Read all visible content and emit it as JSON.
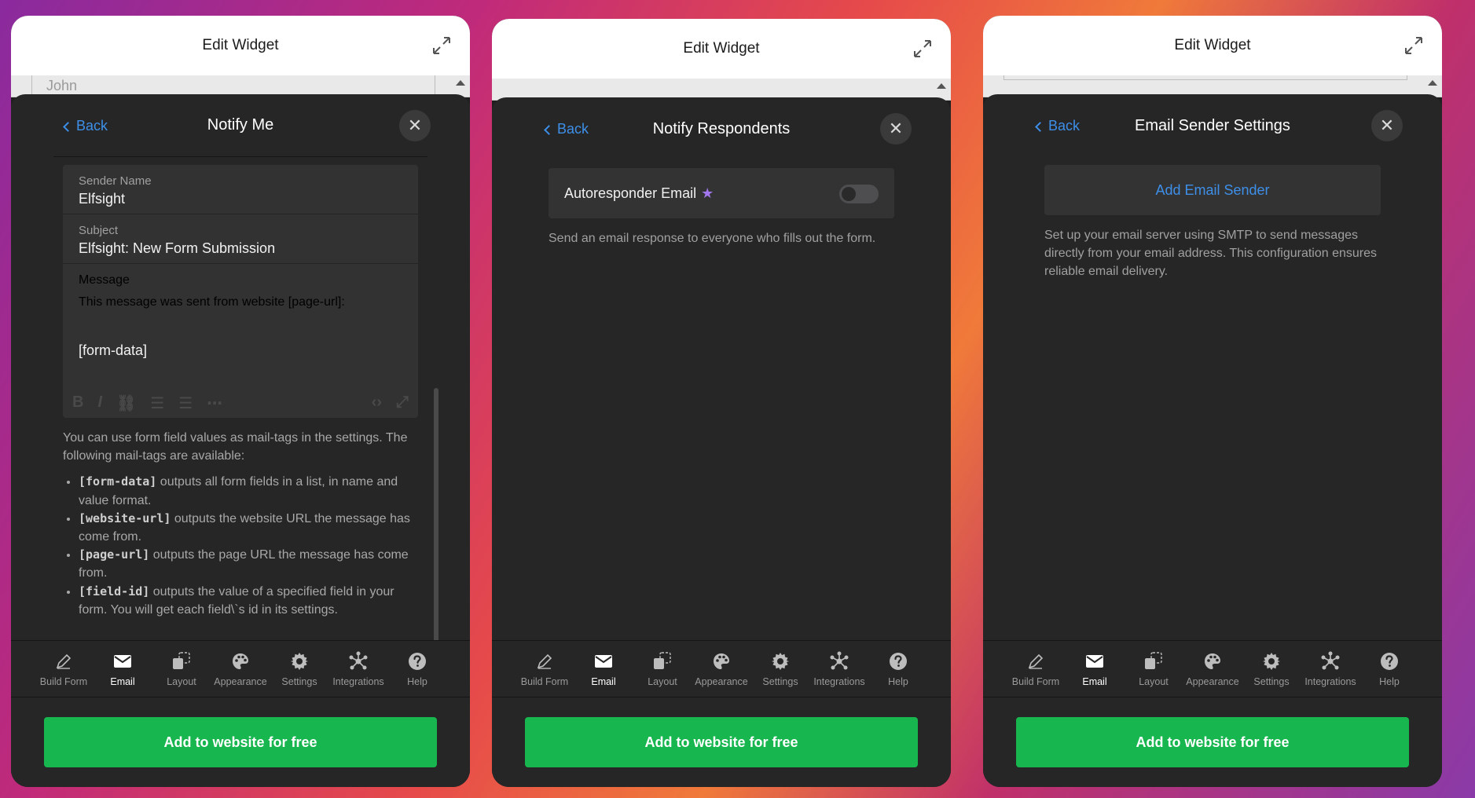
{
  "colors": {
    "accent": "#3d8fe8",
    "cta": "#17b64f",
    "premium_star": "#a276ee"
  },
  "panel1": {
    "window_title": "Edit Widget",
    "behind_input_value": "John",
    "back_label": "Back",
    "title": "Notify Me",
    "sender_name": {
      "label": "Sender Name",
      "value": "Elfsight"
    },
    "subject": {
      "label": "Subject",
      "value": "Elfsight: New Form Submission"
    },
    "message": {
      "label": "Message",
      "line1": "This message was sent from website [page-url]:",
      "line2": "[form-data]"
    },
    "help_intro": "You can use form field values as mail-tags in the settings. The following mail-tags are available:",
    "tags": [
      {
        "tag": "[form-data]",
        "text": " outputs all form fields in a list, in name and value format."
      },
      {
        "tag": "[website-url]",
        "text": " outputs the website URL the message has come from."
      },
      {
        "tag": "[page-url]",
        "text": " outputs the page URL the message has come from."
      },
      {
        "tag": "[field-id]",
        "text": " outputs the value of a specified field in your form. You will get each field\\`s id in its settings."
      }
    ],
    "cta": "Add to website for free"
  },
  "panel2": {
    "window_title": "Edit Widget",
    "back_label": "Back",
    "title": "Notify Respondents",
    "autoresponder_label": "Autoresponder Email",
    "autoresponder_enabled": false,
    "description": "Send an email response to everyone who fills out the form.",
    "cta": "Add to website for free"
  },
  "panel3": {
    "window_title": "Edit Widget",
    "back_label": "Back",
    "title": "Email Sender Settings",
    "add_sender_label": "Add Email Sender",
    "description": "Set up your email server using SMTP to send messages directly from your email address. This configuration ensures reliable email delivery.",
    "cta": "Add to website for free"
  },
  "tabs": [
    {
      "label": "Build Form",
      "icon": "pencil-icon"
    },
    {
      "label": "Email",
      "icon": "envelope-icon",
      "active": true
    },
    {
      "label": "Layout",
      "icon": "layout-icon"
    },
    {
      "label": "Appearance",
      "icon": "palette-icon"
    },
    {
      "label": "Settings",
      "icon": "gear-icon"
    },
    {
      "label": "Integrations",
      "icon": "integrations-icon"
    },
    {
      "label": "Help",
      "icon": "question-icon"
    }
  ]
}
